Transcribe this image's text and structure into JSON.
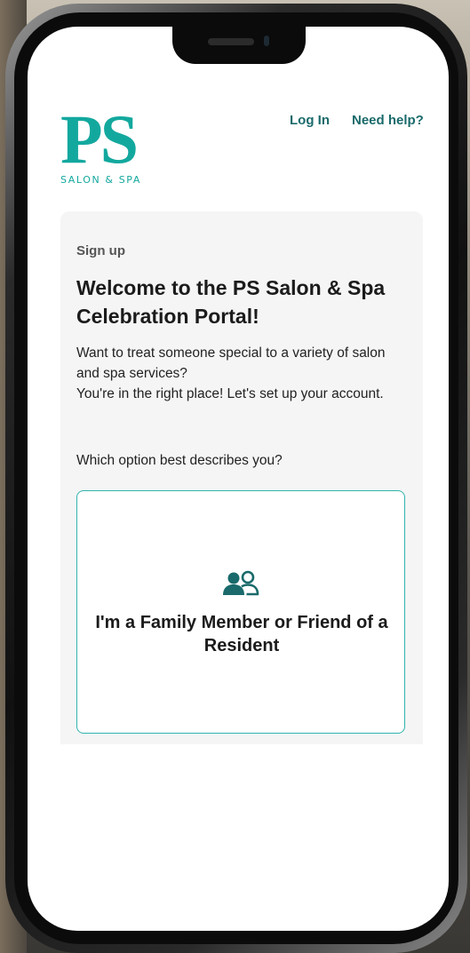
{
  "header": {
    "logo_text": "PS",
    "logo_subtitle": "SALON & SPA",
    "login_label": "Log In",
    "help_label": "Need help?"
  },
  "signup": {
    "eyebrow": "Sign up",
    "heading": "Welcome to the PS Salon & Spa Celebration Portal!",
    "intro_line1": "Want to treat someone special to a variety of salon and spa services?",
    "intro_line2": "You're in the right place! Let's set up your account.",
    "question": "Which option best describes you?",
    "options": [
      {
        "label": "I'm a Family Member or Friend of a Resident",
        "icon": "people-icon"
      }
    ]
  },
  "colors": {
    "brand": "#13a89e",
    "link": "#1a6a6b",
    "option_border": "#30b3ac",
    "card_background": "#f5f5f5"
  }
}
